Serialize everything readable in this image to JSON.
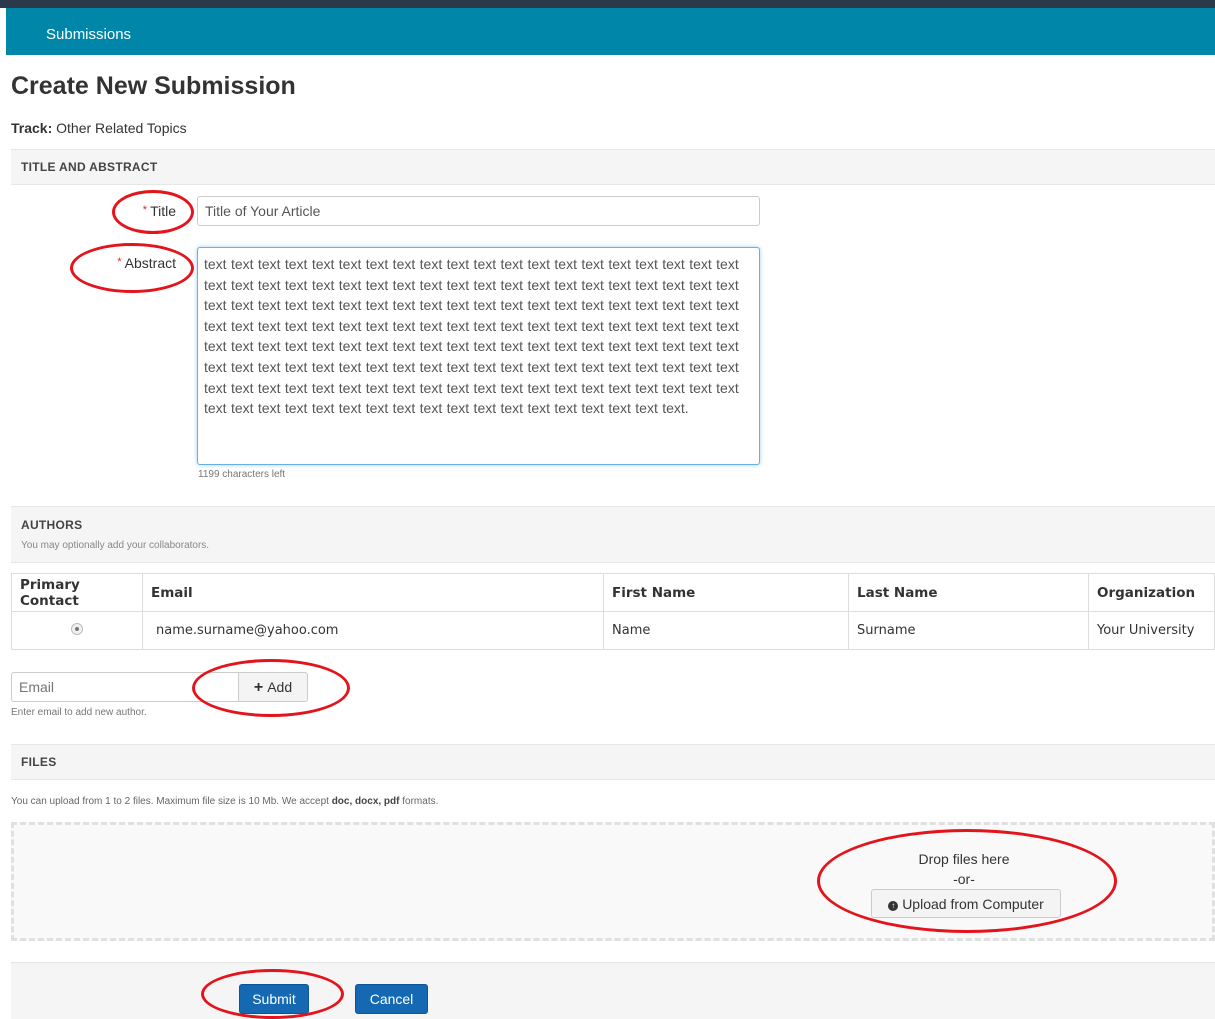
{
  "nav": {
    "submissions_link": "Submissions"
  },
  "page": {
    "title": "Create New Submission",
    "track_label": "Track:",
    "track_value": "Other Related Topics"
  },
  "sections": {
    "title_abstract": "TITLE AND ABSTRACT",
    "authors": "AUTHORS",
    "authors_sub": "You may optionally add your collaborators.",
    "files": "FILES"
  },
  "form": {
    "required_mark": "*",
    "title_label": "Title",
    "title_value": "Title of Your Article",
    "abstract_label": "Abstract",
    "abstract_value": "text text text text text text text text text text text text text text text text text text text text text text text text text text text text text text text text text text text text text text text text text text text text text text text text text text text text text text text text text text text text text text text text text text text text text text text text text text text text text text text text text text text text text text text text text text text text text text text text text text text text text text text text text text text text text text text text text text text text text text text text text text text text text text text text text text text text text text text text text text text text text text text text text text text text text text text text text text text text text text.",
    "chars_left": "1199 characters left"
  },
  "authors_table": {
    "headers": [
      "Primary Contact",
      "Email",
      "First Name",
      "Last Name",
      "Organization"
    ],
    "rows": [
      {
        "email": "name.surname@yahoo.com",
        "first_name": "Name",
        "last_name": "Surname",
        "organization": "Your University"
      }
    ]
  },
  "add_author": {
    "email_placeholder": "Email",
    "add_button": "Add",
    "hint": "Enter email to add new author."
  },
  "files": {
    "info_prefix": "You can upload from 1 to 2 files. Maximum file size is 10 Mb. We accept ",
    "info_formats": "doc, docx, pdf",
    "info_suffix": " formats.",
    "drop_text": "Drop files here",
    "or_text": "-or-",
    "upload_button": "Upload from Computer"
  },
  "actions": {
    "submit": "Submit",
    "cancel": "Cancel"
  },
  "colors": {
    "navbar": "#0086a8",
    "primary_button": "#1569b3",
    "annotation": "#e3141b"
  }
}
